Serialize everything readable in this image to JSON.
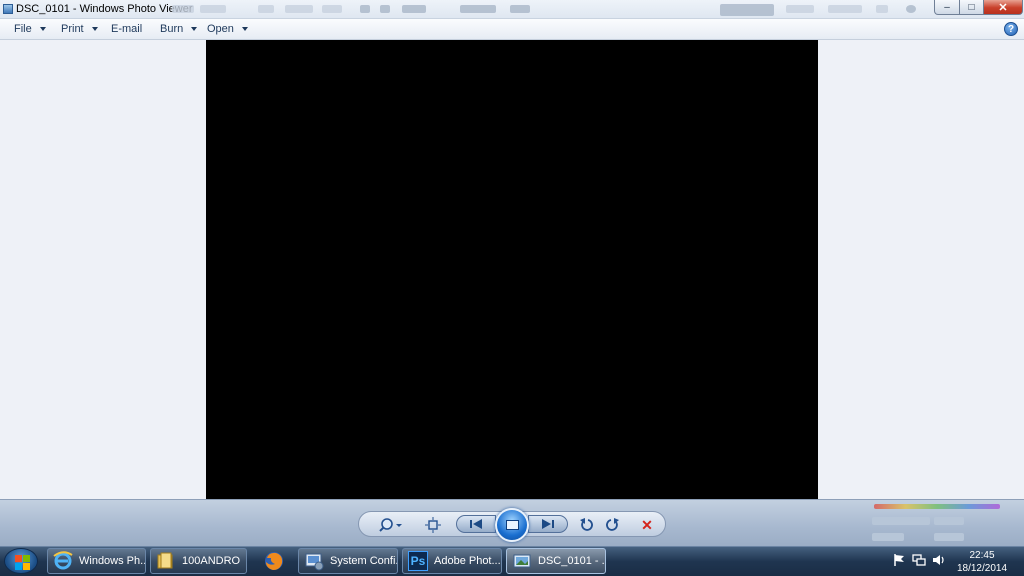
{
  "window": {
    "title": "DSC_0101 - Windows Photo Viewer",
    "controls": {
      "minimize": "–",
      "maximize": "□",
      "close": "✕"
    }
  },
  "menubar": {
    "items": [
      {
        "label": "File",
        "dropdown": true
      },
      {
        "label": "Print",
        "dropdown": true
      },
      {
        "label": "E-mail",
        "dropdown": false
      },
      {
        "label": "Burn",
        "dropdown": true
      },
      {
        "label": "Open",
        "dropdown": true
      }
    ],
    "help_icon": "?"
  },
  "viewer": {
    "image_fill": "#000000",
    "background": "#eef1f7"
  },
  "controls": {
    "buttons": [
      "zoom-icon",
      "fit-to-window-icon",
      "previous-icon",
      "slideshow-icon",
      "next-icon",
      "rotate-counterclockwise-icon",
      "rotate-clockwise-icon",
      "delete-icon"
    ],
    "delete_glyph": "✕"
  },
  "taskbar": {
    "buttons": [
      {
        "label": "Windows Ph...",
        "icon": "internet-explorer-icon",
        "active": false
      },
      {
        "label": "100ANDRO",
        "icon": "folder-icon",
        "active": false
      },
      {
        "label": "",
        "icon": "firefox-icon",
        "active": false
      },
      {
        "label": "System Confi...",
        "icon": "system-configuration-icon",
        "active": false
      },
      {
        "label": "Adobe Phot...",
        "icon": "photoshop-icon",
        "active": false
      },
      {
        "label": "DSC_0101 - ...",
        "icon": "photo-viewer-icon",
        "active": true
      }
    ],
    "photoshop_icon_text": "Ps",
    "clock": {
      "time": "22:45",
      "date": "18/12/2014"
    },
    "tray_icons": [
      "action-center-flag-icon",
      "network-icon",
      "volume-icon"
    ]
  }
}
